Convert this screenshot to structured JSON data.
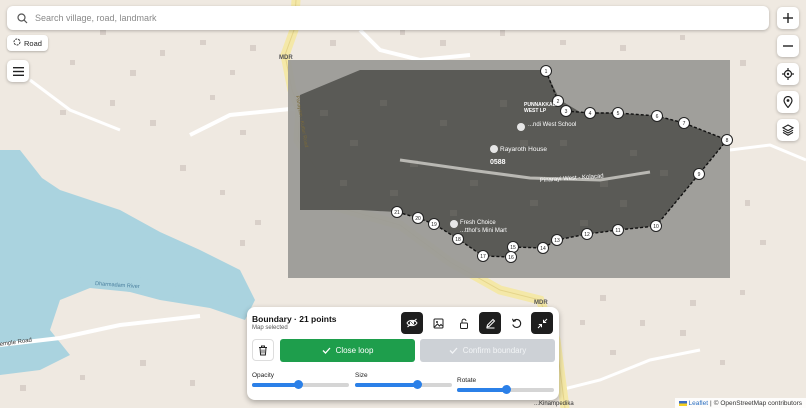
{
  "search": {
    "placeholder": "Search village, road, landmark"
  },
  "layer_chip": {
    "label": "Road"
  },
  "map": {
    "labels": {
      "school": "...ndi West School",
      "school_top1": "PUNNAKKAL",
      "school_top2": "WEST LP",
      "house": "Rayaroth House",
      "place_code": "0588",
      "road": "Pinarayi West - Kolacad",
      "shop1": "Fresh Choice",
      "shop2": "...tthol's Mini Mart",
      "road_left": "Panayam - Kuttur Road",
      "mdr_top": "MDR",
      "mdr_bottom": "MDR",
      "river": "Dharmadam River",
      "temple_road": "emple Road",
      "bottom_road": "...Kinampedika"
    },
    "boundary_points": [
      "1",
      "2",
      "3",
      "4",
      "5",
      "6",
      "7",
      "8",
      "9",
      "10",
      "11",
      "12",
      "13",
      "14",
      "15",
      "16",
      "17",
      "18",
      "19",
      "20",
      "21"
    ]
  },
  "panel": {
    "title": "Boundary · 21 points",
    "subtitle": "Map selected",
    "close_loop": "Close loop",
    "confirm": "Confirm boundary",
    "opacity_label": "Opacity",
    "size_label": "Size",
    "rotate_label": "Rotate",
    "opacity_value": 0.47,
    "size_value": 0.64,
    "rotate_value": 0.5
  },
  "attribution": {
    "leaflet": "Leaflet",
    "separator": "|",
    "osm": "© OpenStreetMap contributors"
  },
  "colors": {
    "accent_green": "#1e9e4c",
    "slider_blue": "#2b80e8",
    "disabled_gray": "#cdd1d6",
    "water": "#aad3df"
  }
}
